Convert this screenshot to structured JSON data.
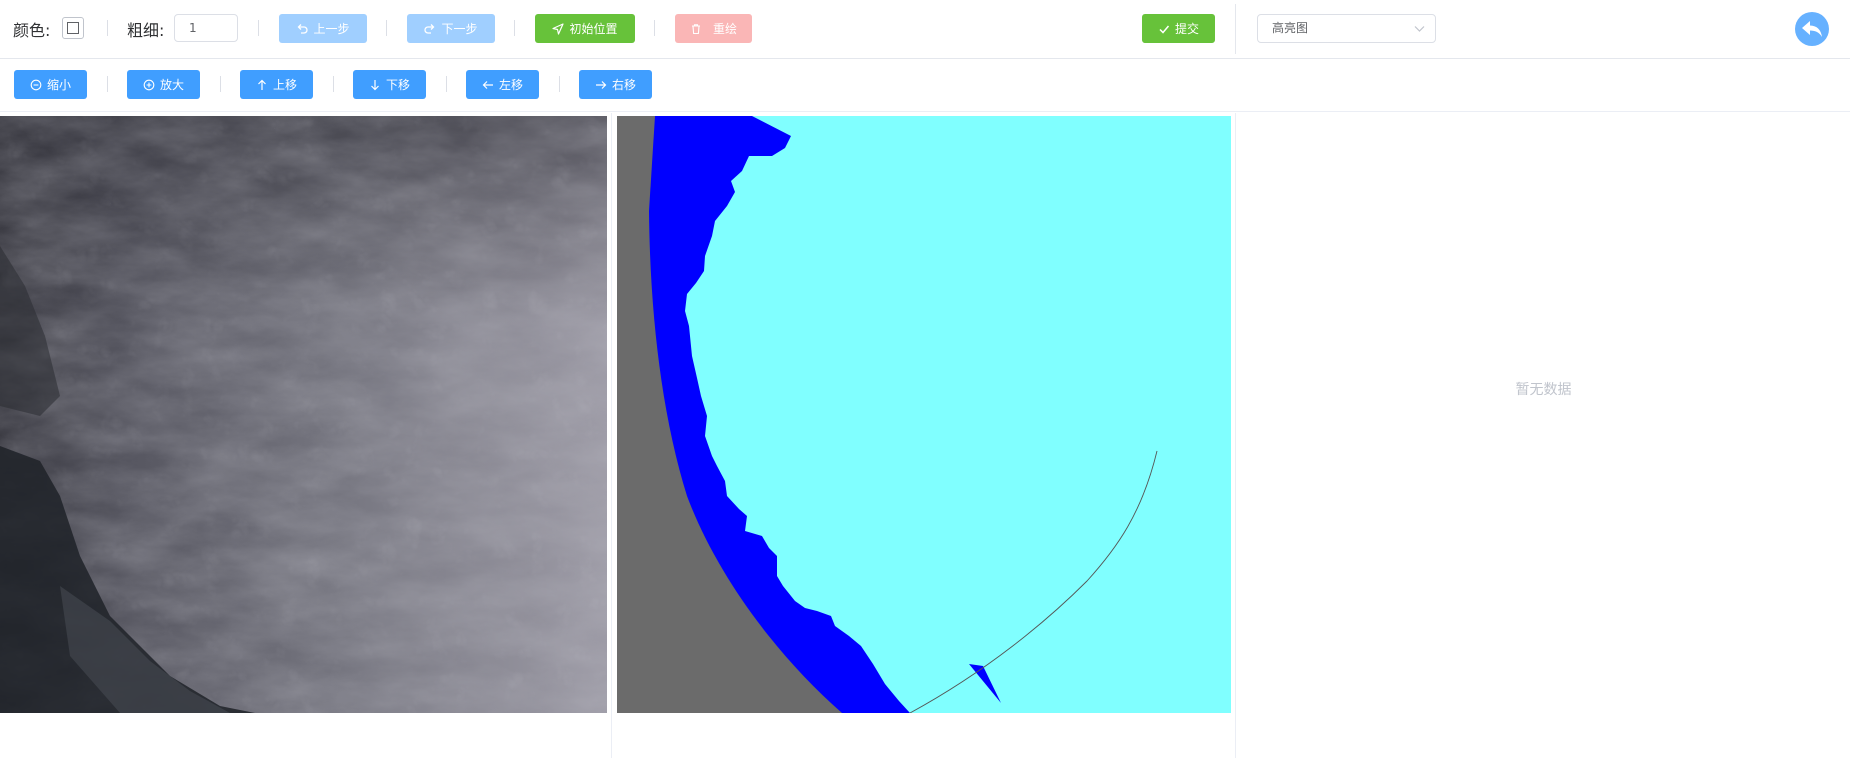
{
  "toolbar": {
    "color_label": "颜色:",
    "thickness_label": "粗细:",
    "thickness_value": "1",
    "undo_label": "上一步",
    "redo_label": "下一步",
    "reset_position_label": "初始位置",
    "redraw_label": "重绘",
    "submit_label": "提交",
    "view_select": {
      "selected": "高亮图"
    }
  },
  "nav": {
    "zoom_out_label": "缩小",
    "zoom_in_label": "放大",
    "move_up_label": "上移",
    "move_down_label": "下移",
    "move_left_label": "左移",
    "move_right_label": "右移"
  },
  "panels": {
    "empty_text": "暂无数据"
  },
  "colors": {
    "primary": "#409eff",
    "primary_disabled": "#a0cfff",
    "success": "#67c23a",
    "danger_disabled": "#fab6b6",
    "mask_ice": "#80ffff",
    "mask_water": "#0000ff",
    "mask_nodata": "#6b6b6b"
  }
}
